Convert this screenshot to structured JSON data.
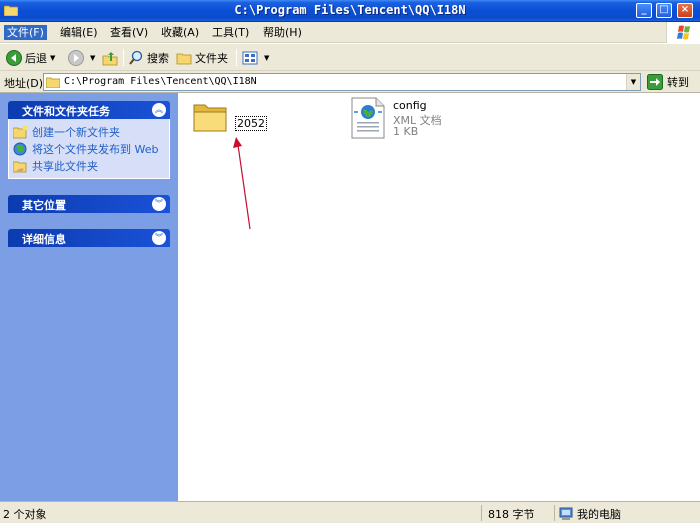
{
  "window": {
    "title": "C:\\Program Files\\Tencent\\QQ\\I18N",
    "minimize": "_",
    "maximize": "□",
    "close": "×"
  },
  "menu": [
    "文件(F)",
    "编辑(E)",
    "查看(V)",
    "收藏(A)",
    "工具(T)",
    "帮助(H)"
  ],
  "toolbar": {
    "back": "后退",
    "search": "搜索",
    "folders": "文件夹"
  },
  "address": {
    "label": "地址(D)",
    "path": "C:\\Program Files\\Tencent\\QQ\\I18N",
    "go": "转到"
  },
  "left_pane": {
    "file_tasks": {
      "title": "文件和文件夹任务",
      "items": [
        "创建一个新文件夹",
        "将这个文件夹发布到 Web",
        "共享此文件夹"
      ]
    },
    "other_places": {
      "title": "其它位置"
    },
    "details": {
      "title": "详细信息"
    }
  },
  "files": [
    {
      "name": "2052",
      "kind": "folder"
    },
    {
      "name": "config",
      "type": "XML 文档",
      "size": "1 KB",
      "kind": "xml"
    }
  ],
  "status": {
    "objects": "2 个对象",
    "bytes": "818 字节",
    "location": "我的电脑"
  },
  "colors": {
    "title_bar": "#0a4fd6",
    "task_pane": "#7b9ee5",
    "link": "#215dc6",
    "annotation_arrow": "#c8102e"
  }
}
